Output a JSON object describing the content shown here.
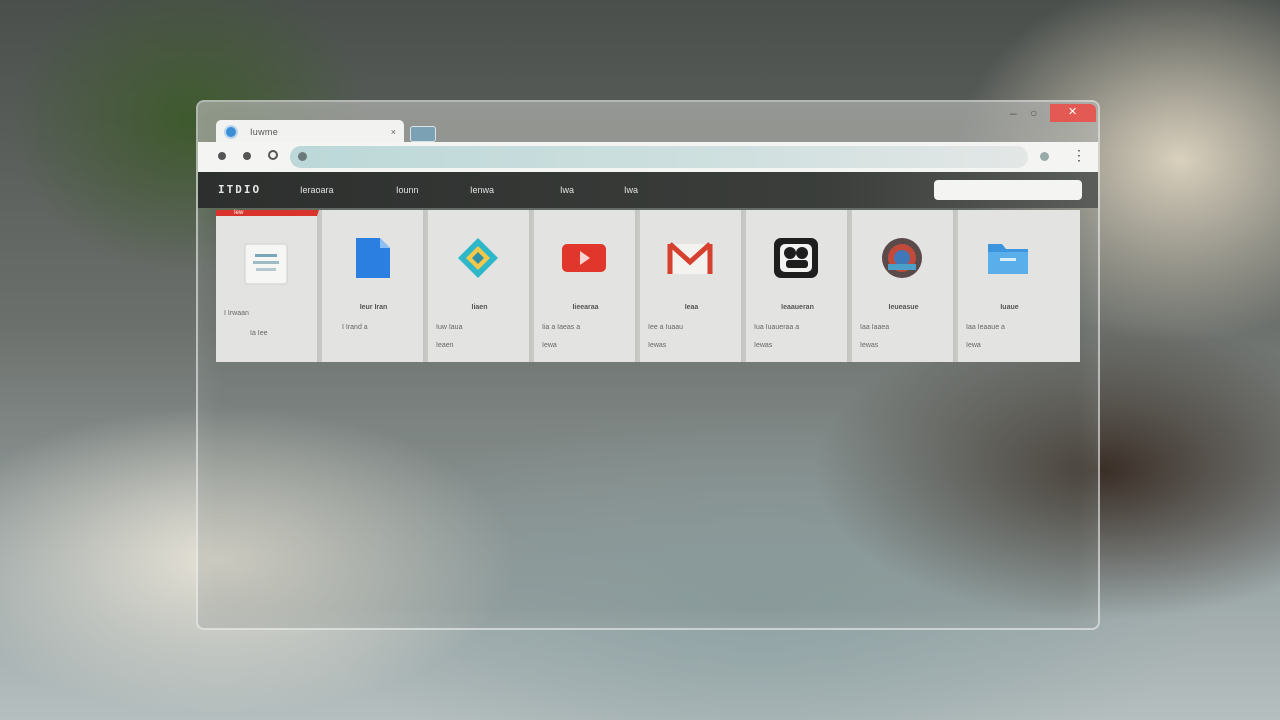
{
  "browser": {
    "tab_title": "Iuwme",
    "tab_close": "×",
    "window_minimize": "–",
    "window_maximize": "○",
    "window_close": "✕",
    "menu_icon": "⋮"
  },
  "app": {
    "logo": "ITDIO",
    "nav": [
      "Ieraoara",
      "Iounn",
      "Ienwa",
      "Iwa",
      "Iwa"
    ],
    "search_placeholder": ""
  },
  "cards": [
    {
      "icon": "document-icon",
      "selected_label": "Iew",
      "title": "I Irwaan",
      "lines": [
        "Ia Iee",
        ""
      ]
    },
    {
      "icon": "file-icon",
      "title": "Ieur Iran",
      "lines": [
        "I Irand  a",
        ""
      ]
    },
    {
      "icon": "drive-icon",
      "title": "Iiaen",
      "lines": [
        "Iuw Iaua",
        "Ieaen"
      ]
    },
    {
      "icon": "video-icon",
      "title": "Iieearaa",
      "lines": [
        "Iia a Iaeas  a",
        "Iewa"
      ]
    },
    {
      "icon": "mail-icon",
      "title": "Ieaa",
      "lines": [
        "Iee a Iuaau",
        "Iewas"
      ]
    },
    {
      "icon": "media-icon",
      "title": "Ieaaueran",
      "lines": [
        "Iua Iuaueraa  a",
        "Iewas"
      ]
    },
    {
      "icon": "globe-icon",
      "title": "Ieueasue",
      "lines": [
        "Iaa Iaaea",
        "Iewas"
      ]
    },
    {
      "icon": "folder-icon",
      "title": "Iuaue",
      "lines": [
        "Iaa Ieaaue a",
        "Iewa"
      ]
    }
  ],
  "colors": {
    "accent_red": "#d8342b",
    "chrome_blue": "#3a8fd6"
  }
}
